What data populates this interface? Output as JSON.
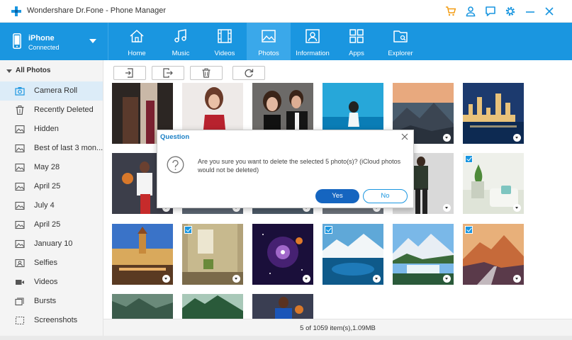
{
  "window": {
    "title": "Wondershare Dr.Fone - Phone Manager",
    "title_icons": [
      "cart-icon",
      "user-icon",
      "feedback-icon",
      "settings-icon",
      "minimize-icon",
      "close-icon"
    ]
  },
  "device": {
    "name": "iPhone",
    "status": "Connected"
  },
  "nav": [
    {
      "label": "Home",
      "icon": "home-icon"
    },
    {
      "label": "Music",
      "icon": "music-icon"
    },
    {
      "label": "Videos",
      "icon": "videos-icon"
    },
    {
      "label": "Photos",
      "icon": "photos-icon",
      "active": true
    },
    {
      "label": "Information",
      "icon": "information-icon"
    },
    {
      "label": "Apps",
      "icon": "apps-icon"
    },
    {
      "label": "Explorer",
      "icon": "explorer-icon"
    }
  ],
  "sidebar": {
    "header": "All Photos",
    "items": [
      {
        "label": "Camera Roll",
        "icon": "camera-icon",
        "active": true
      },
      {
        "label": "Recently Deleted",
        "icon": "trash-icon"
      },
      {
        "label": "Hidden",
        "icon": "image-icon"
      },
      {
        "label": "Best of last 3 mon...",
        "icon": "image-icon"
      },
      {
        "label": "May 28",
        "icon": "image-icon"
      },
      {
        "label": "April 25",
        "icon": "image-icon"
      },
      {
        "label": "July 4",
        "icon": "image-icon"
      },
      {
        "label": "April 25",
        "icon": "image-icon"
      },
      {
        "label": "January 10",
        "icon": "image-icon"
      },
      {
        "label": "Selfies",
        "icon": "selfie-icon"
      },
      {
        "label": "Videos",
        "icon": "video-icon"
      },
      {
        "label": "Bursts",
        "icon": "bursts-icon"
      },
      {
        "label": "Screenshots",
        "icon": "screenshot-icon"
      }
    ]
  },
  "toolbar": {
    "buttons": [
      "import-icon",
      "export-icon",
      "delete-icon",
      "refresh-icon"
    ]
  },
  "photos": [
    {
      "selected": false
    },
    {
      "selected": false
    },
    {
      "selected": false
    },
    {
      "selected": false
    },
    {
      "selected": false
    },
    {
      "selected": false
    },
    {
      "selected": false
    },
    {
      "selected": false
    },
    {
      "selected": false
    },
    {
      "selected": false
    },
    {
      "selected": false
    },
    {
      "selected": true
    },
    {
      "selected": false
    },
    {
      "selected": true
    },
    {
      "selected": false
    },
    {
      "selected": true
    },
    {
      "selected": false
    },
    {
      "selected": true
    },
    {
      "selected": false
    },
    {
      "selected": false
    },
    {
      "selected": false
    }
  ],
  "status": {
    "text": "5 of 1059 item(s),1.09MB"
  },
  "dialog": {
    "title": "Question",
    "message": "Are you sure you want to delete the selected 5 photo(s)? (iCloud photos would not be deleted)",
    "yes_label": "Yes",
    "no_label": "No"
  },
  "colors": {
    "accent": "#1a96e0",
    "nav_active": "#3aa8ea",
    "primary_button": "#1565c0"
  }
}
